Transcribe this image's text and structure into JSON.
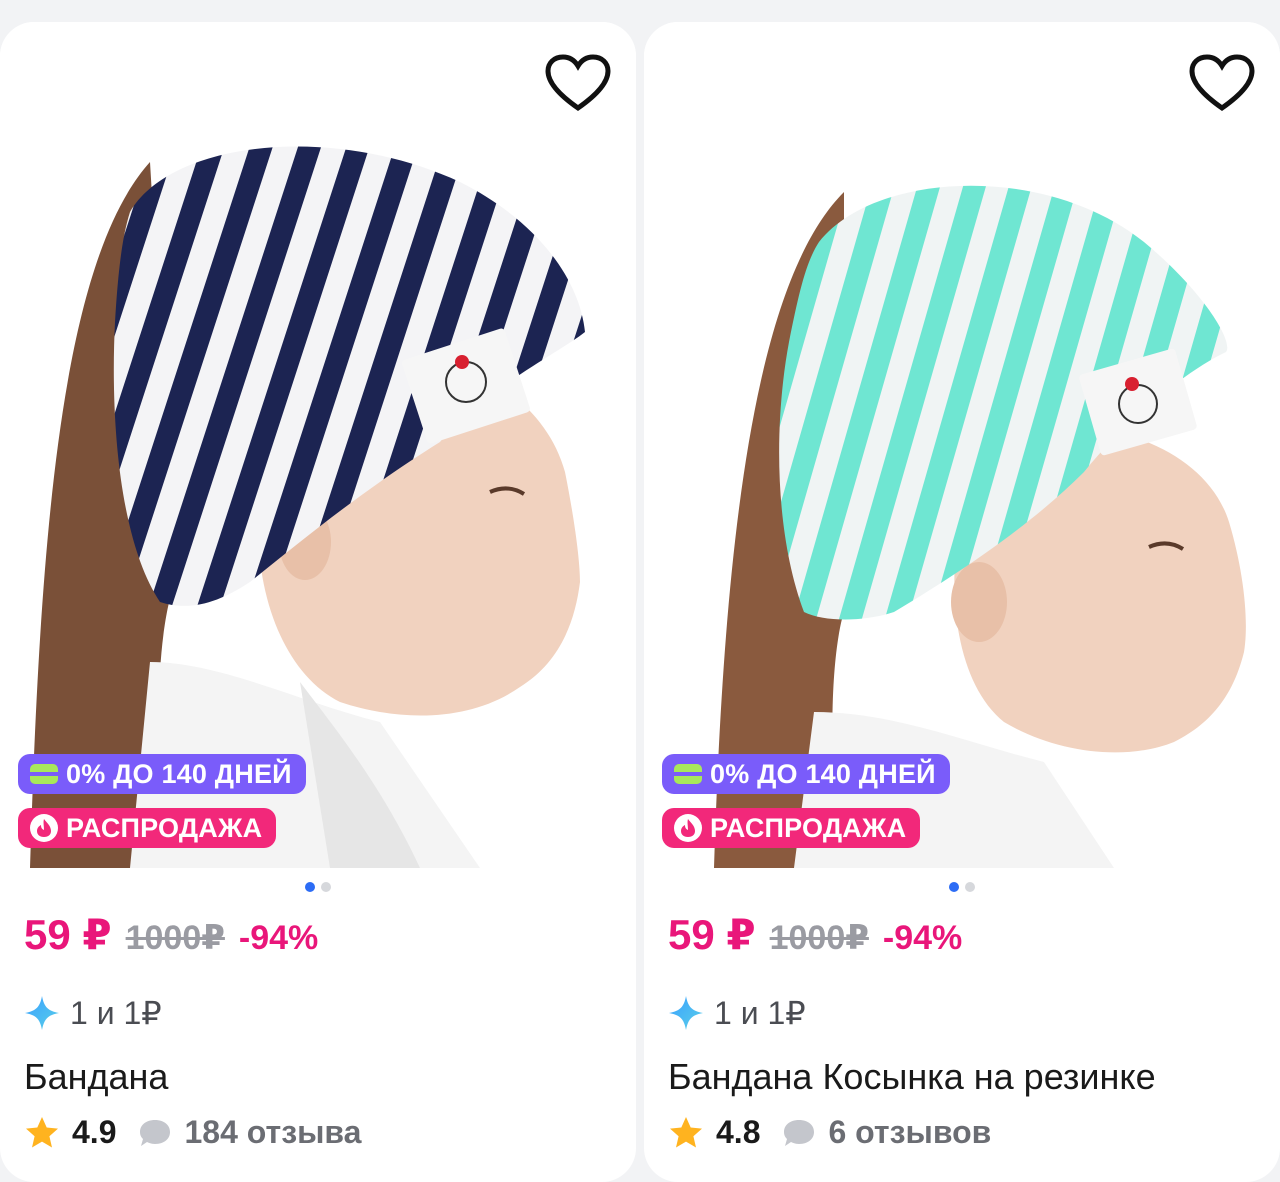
{
  "colors": {
    "accent_pink": "#e9167a",
    "bnpl_badge": "#7a5cfa",
    "sale_badge": "#f2287a",
    "dot_active": "#2c6cf5",
    "headband_left": "#1c2452",
    "headband_right": "#5ee8d0"
  },
  "products": [
    {
      "bnpl_badge": "0% ДО 140 ДНЕЙ",
      "sale_badge": "РАСПРОДАЖА",
      "price": "59 ₽",
      "old_price": "1000₽",
      "discount": "-94%",
      "promo": "1 и 1₽",
      "title": "Бандана",
      "rating": "4.9",
      "reviews": "184 отзыва",
      "icons": [
        "heart-outline-icon",
        "card-icon",
        "fire-icon",
        "sparkle-icon",
        "star-icon",
        "chat-bubble-icon"
      ]
    },
    {
      "bnpl_badge": "0% ДО 140 ДНЕЙ",
      "sale_badge": "РАСПРОДАЖА",
      "price": "59 ₽",
      "old_price": "1000₽",
      "discount": "-94%",
      "promo": "1 и 1₽",
      "title": "Бандана Косынка на резинке",
      "rating": "4.8",
      "reviews": "6 отзывов",
      "icons": [
        "heart-outline-icon",
        "card-icon",
        "fire-icon",
        "sparkle-icon",
        "star-icon",
        "chat-bubble-icon"
      ]
    }
  ]
}
